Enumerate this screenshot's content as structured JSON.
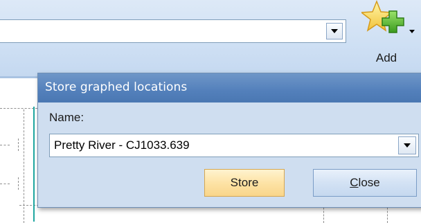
{
  "toolbar": {
    "location_value": "",
    "add_label": "Add",
    "add_icon": "star-plus-icon"
  },
  "dialog": {
    "title": "Store graphed locations",
    "name_label": "Name:",
    "name_value": "Pretty River - CJ1033.639",
    "store_label": "Store",
    "close_mnemonic": "C",
    "close_rest": "lose"
  },
  "colors": {
    "toolbar_bg": "#cfe0f4",
    "dialog_title_bg": "#5380bb",
    "dialog_bg": "#cfdef0",
    "store_button_bg": "#fde3a6",
    "close_button_bg": "#d3e2f4",
    "graph_line": "#1fa6a0"
  }
}
